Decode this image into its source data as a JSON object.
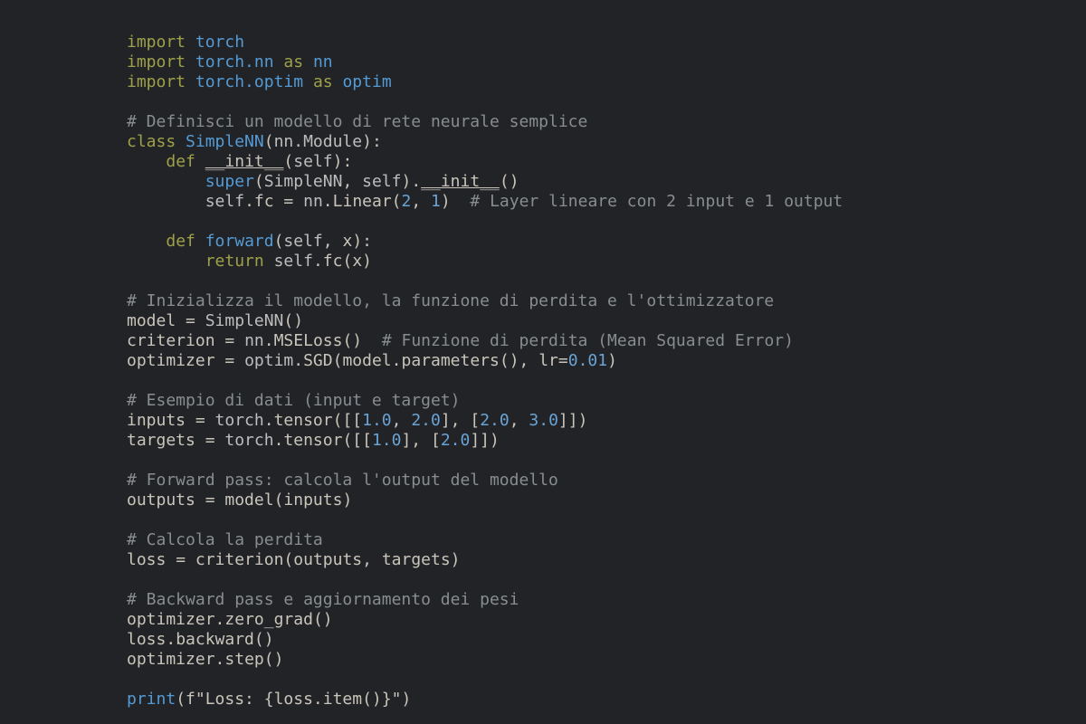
{
  "tok": {
    "import": "import",
    "class": "class",
    "def": "def",
    "return": "return",
    "as": "as",
    "torch": "torch",
    "torchnn": "torch.nn",
    "nn": "nn",
    "torchoptim": "torch.optim",
    "optim": "optim",
    "cmt1": "# Definisci un modello di rete neurale semplice",
    "SimpleNN": "SimpleNN",
    "nnModule": "nn.Module",
    "init": "__init__",
    "self": "self",
    "super": "super",
    "fc": "fc",
    "Linear": "Linear",
    "two": "2",
    "one": "1",
    "cmt2": "# Layer lineare con 2 input e 1 output",
    "forward": "forward",
    "x": "x",
    "cmt3": "# Inizializza il modello, la funzione di perdita e l'ottimizzatore",
    "model": "model",
    "criterion": "criterion",
    "MSELoss": "MSELoss",
    "cmt4": "# Funzione di perdita (Mean Squared Error)",
    "optimizer": "optimizer",
    "SGD": "SGD",
    "parameters": "parameters",
    "lr": "lr",
    "p01": "0.01",
    "cmt5": "# Esempio di dati (input e target)",
    "inputs": "inputs",
    "tensor": "tensor",
    "one0": "1.0",
    "two0": "2.0",
    "three0": "3.0",
    "targets": "targets",
    "cmt6": "# Forward pass: calcola l'output del modello",
    "outputs": "outputs",
    "cmt7": "# Calcola la perdita",
    "loss": "loss",
    "cmt8": "# Backward pass e aggiornamento dei pesi",
    "zerograd": "zero_grad",
    "backward": "backward",
    "step": "step",
    "print": "print",
    "fstr": "f\"Loss: {loss.item()}\"",
    "eq": " = "
  }
}
